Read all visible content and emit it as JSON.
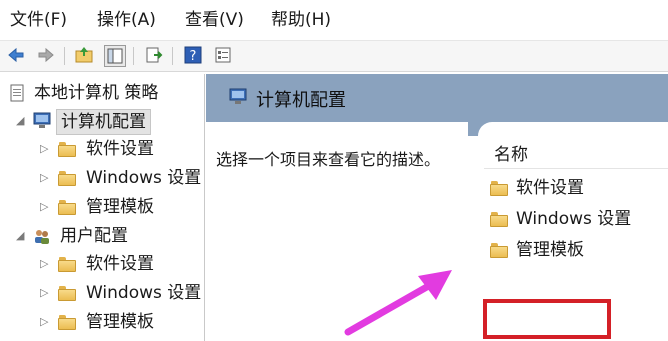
{
  "menu": [
    {
      "label": "文件(F)"
    },
    {
      "label": "操作(A)"
    },
    {
      "label": "查看(V)"
    },
    {
      "label": "帮助(H)"
    }
  ],
  "toolbar": {
    "icons": [
      "back-arrow-icon",
      "forward-arrow-icon",
      "up-folder-icon",
      "show-hide-tree-icon",
      "export-list-icon",
      "help-icon",
      "properties-icon"
    ]
  },
  "tree": {
    "root": "本地计算机 策略",
    "computer_config": "计算机配置",
    "computer_children": [
      "软件设置",
      "Windows 设置",
      "管理模板"
    ],
    "user_config": "用户配置",
    "user_children": [
      "软件设置",
      "Windows 设置",
      "管理模板"
    ]
  },
  "main": {
    "title": "计算机配置",
    "description": "选择一个项目来查看它的描述。",
    "column_name": "名称",
    "items": [
      "软件设置",
      "Windows 设置",
      "管理模板"
    ]
  },
  "colors": {
    "header_band": "#8aa2be",
    "highlight": "#d42027",
    "annotation_arrow": "#e23be0"
  }
}
